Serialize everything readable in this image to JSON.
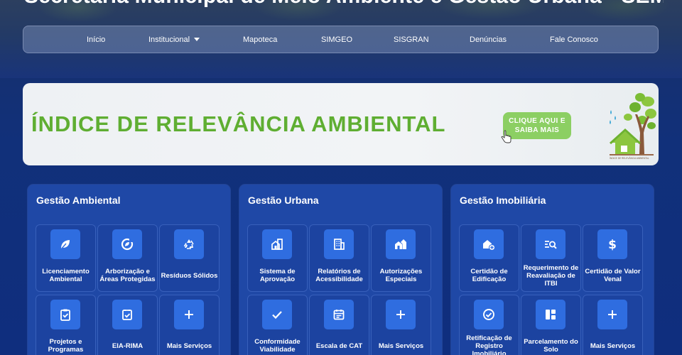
{
  "header": {
    "site_title": "Secretaria Municipal de Meio Ambiente e Gestão Urbana - SEMADUR"
  },
  "nav": {
    "items": [
      {
        "label": "Início"
      },
      {
        "label": "Institucional",
        "has_dropdown": true
      },
      {
        "label": "Mapoteca"
      },
      {
        "label": "SIMGEO"
      },
      {
        "label": "SISGRAN"
      },
      {
        "label": "Denúncias"
      },
      {
        "label": "Fale Conosco"
      }
    ]
  },
  "banner": {
    "title": "ÍNDICE DE RELEVÂNCIA AMBIENTAL",
    "cta_line1": "CLIQUE AQUI E",
    "cta_line2": "SAIBA MAIS",
    "logo_caption": "ÍNDICE DE RELEVÂNCIA AMBIENTAL",
    "title_color": "#5fae32",
    "cta_color": "#8ccf63"
  },
  "cards": [
    {
      "title": "Gestão Ambiental",
      "tiles": [
        {
          "label": "Licenciamento Ambiental",
          "icon": "leaf-icon"
        },
        {
          "label": "Arborização e Áreas Protegidas",
          "icon": "eco-badge-icon"
        },
        {
          "label": "Resíduos Sólidos",
          "icon": "recycle-icon"
        },
        {
          "label": "Projetos e Programas",
          "icon": "clipboard-check-icon"
        },
        {
          "label": "EIA-RIMA",
          "icon": "check-square-icon"
        },
        {
          "label": "Mais Serviços",
          "icon": "plus-icon"
        }
      ]
    },
    {
      "title": "Gestão Urbana",
      "tiles": [
        {
          "label": "Sistema de Aprovação",
          "icon": "house-building-icon"
        },
        {
          "label": "Relatórios de Acessibilidade",
          "icon": "building-icon"
        },
        {
          "label": "Autorizações Especiais",
          "icon": "houses-icon"
        },
        {
          "label": "Conformidade Viabilidade",
          "icon": "check-icon"
        },
        {
          "label": "Escala de CAT",
          "icon": "calendar-icon"
        },
        {
          "label": "Mais Serviços",
          "icon": "plus-icon"
        }
      ]
    },
    {
      "title": "Gestão Imobiliária",
      "tiles": [
        {
          "label": "Certidão de Edificação",
          "icon": "house-plus-icon"
        },
        {
          "label": "Requerimento de Reavaliação de ITBI",
          "icon": "list-search-icon"
        },
        {
          "label": "Certidão de Valor Venal",
          "icon": "dollar-icon"
        },
        {
          "label": "Retificação de Registro Imobiliário",
          "icon": "check-circle-icon"
        },
        {
          "label": "Parcelamento do Solo",
          "icon": "layout-icon"
        },
        {
          "label": "Mais Serviços",
          "icon": "plus-icon"
        }
      ]
    }
  ],
  "colors": {
    "page_bg": "#11307a",
    "card_bg": "#1f48a6",
    "icon_box": "#2f6de0"
  }
}
